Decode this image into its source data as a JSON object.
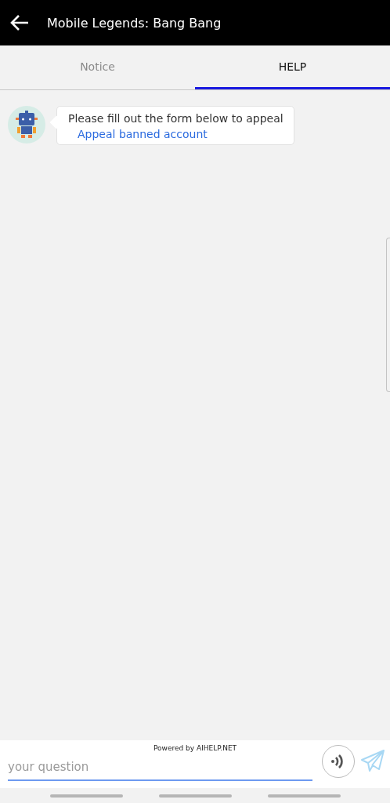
{
  "header": {
    "title": "Mobile Legends: Bang Bang"
  },
  "tabs": [
    {
      "label": "Notice",
      "selected": false
    },
    {
      "label": "HELP",
      "selected": true
    }
  ],
  "messages": [
    {
      "text": "Please fill out the form below to appeal",
      "link": "Appeal banned account"
    }
  ],
  "composer": {
    "powered_by": "Powered by AIHELP.NET",
    "placeholder": "your question"
  }
}
